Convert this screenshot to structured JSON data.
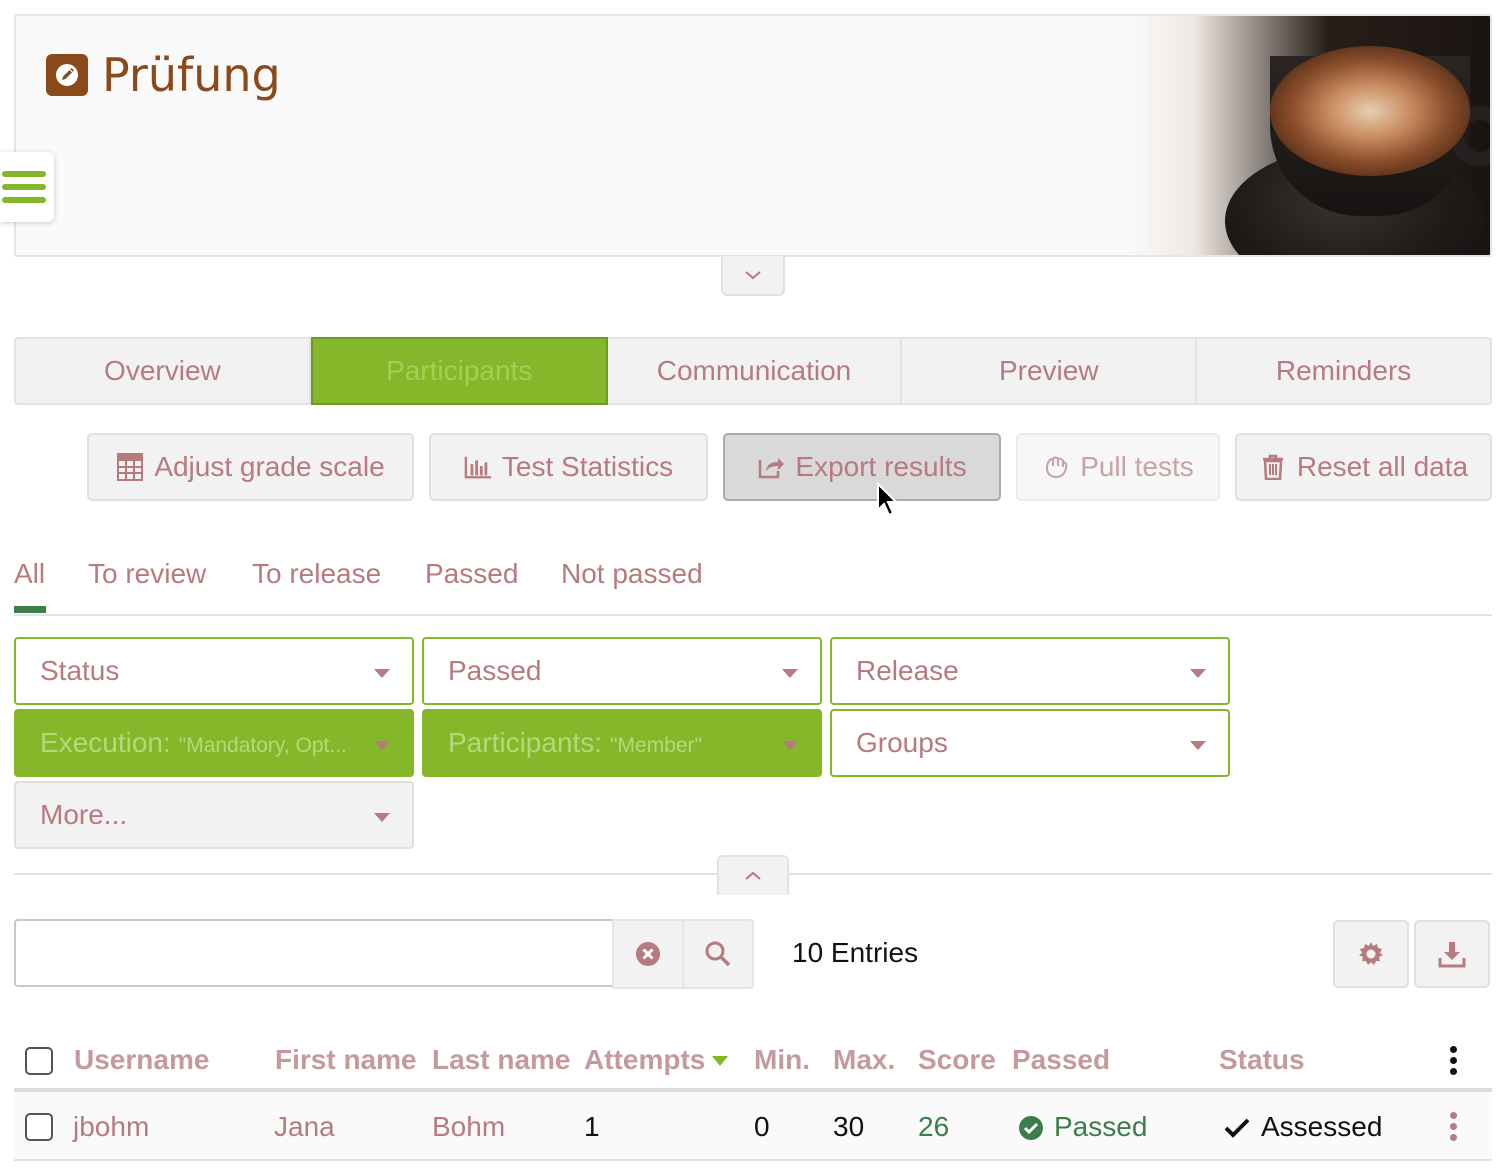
{
  "header": {
    "title": "Prüfung",
    "title_icon": "edit-icon"
  },
  "tabs": [
    {
      "label": "Overview"
    },
    {
      "label": "Participants",
      "active": true
    },
    {
      "label": "Communication"
    },
    {
      "label": "Preview"
    },
    {
      "label": "Reminders"
    }
  ],
  "tools": {
    "adjust_grade_scale": "Adjust grade scale",
    "test_statistics": "Test Statistics",
    "export_results": "Export results",
    "pull_tests": "Pull tests",
    "reset_all_data": "Reset all data"
  },
  "segments": {
    "all": "All",
    "to_review": "To review",
    "to_release": "To release",
    "passed": "Passed",
    "not_passed": "Not passed"
  },
  "filters": {
    "status": "Status",
    "passed": "Passed",
    "release": "Release",
    "execution_label": "Execution:",
    "execution_value": "\"Mandatory, Opt...",
    "participants_label": "Participants:",
    "participants_value": "\"Member\"",
    "groups": "Groups",
    "more": "More..."
  },
  "search": {
    "value": "",
    "entries": "10 Entries"
  },
  "table": {
    "columns": {
      "username": "Username",
      "first_name": "First name",
      "last_name": "Last name",
      "attempts": "Attempts",
      "min": "Min.",
      "max": "Max.",
      "score": "Score",
      "passed": "Passed",
      "status": "Status"
    },
    "rows": [
      {
        "username": "jbohm",
        "first_name": "Jana",
        "last_name": "Bohm",
        "attempts": "1",
        "min": "0",
        "max": "30",
        "score": "26",
        "passed": "Passed",
        "status": "Assessed"
      }
    ]
  },
  "colors": {
    "accent_green": "#84b82a",
    "brand_brown": "#8b4a1c",
    "link_pink": "#b77a7f",
    "passed_green": "#3c7d4c"
  }
}
